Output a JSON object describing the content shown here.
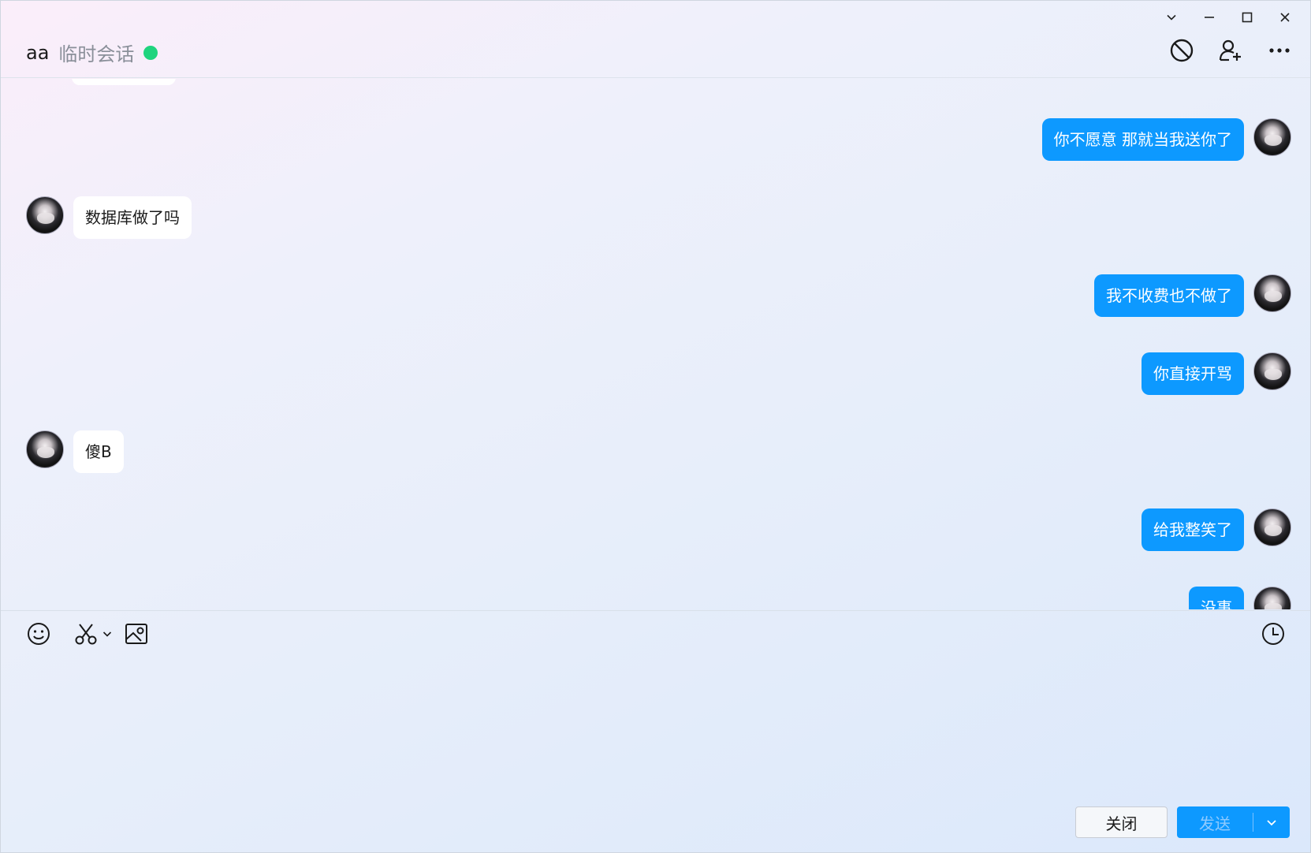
{
  "header": {
    "contact_name": "aa",
    "subtitle": "临时会话",
    "online_color": "#1fd47e",
    "actions": [
      "block-icon",
      "add-contact-icon",
      "more-icon"
    ]
  },
  "window_controls": [
    "chevron-down-icon",
    "minimize-icon",
    "maximize-icon",
    "close-icon"
  ],
  "messages": [
    {
      "side": "right",
      "text": "你不愿意 那就当我送你了"
    },
    {
      "side": "left",
      "text": "数据库做了吗"
    },
    {
      "side": "right",
      "text": "我不收费也不做了"
    },
    {
      "side": "right",
      "text": "你直接开骂"
    },
    {
      "side": "left",
      "text": "傻B"
    },
    {
      "side": "right",
      "text": "给我整笑了"
    },
    {
      "side": "right",
      "text": "没事"
    }
  ],
  "toolbar": {
    "left_tools": [
      "emoji-icon",
      "screenshot-scissors-icon",
      "image-icon"
    ],
    "right_tools": [
      "history-clock-icon"
    ]
  },
  "input": {
    "value": "",
    "placeholder": ""
  },
  "footer": {
    "close_label": "关闭",
    "send_label": "发送"
  },
  "colors": {
    "accent": "#0d99ff",
    "incoming_bubble": "#ffffff",
    "outgoing_text": "#ffffff"
  }
}
